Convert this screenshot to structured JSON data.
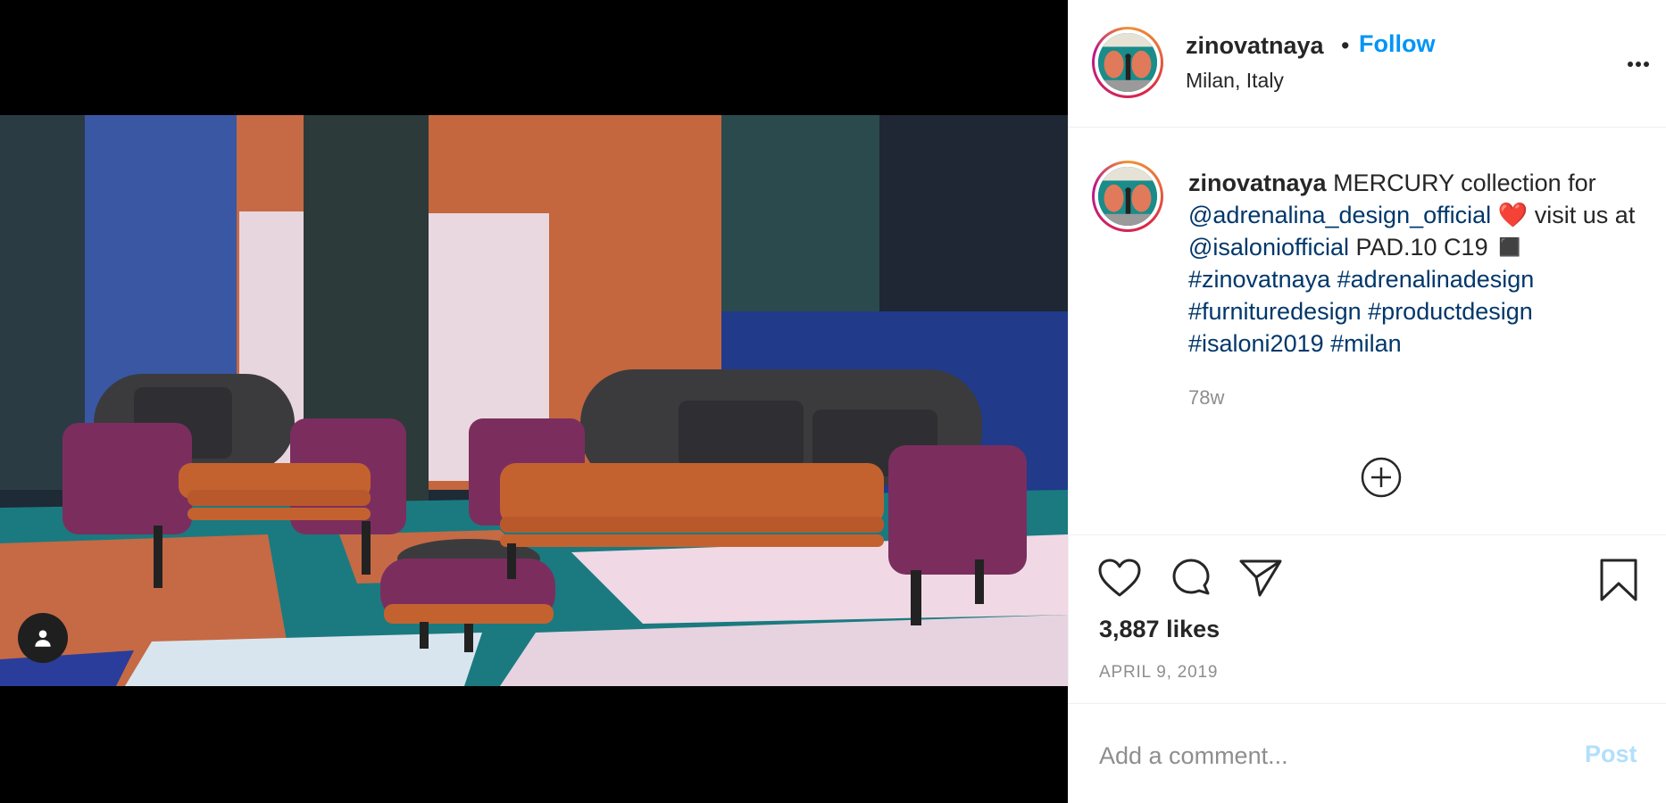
{
  "post": {
    "username": "zinovatnaya",
    "separator": "•",
    "follow_label": "Follow",
    "location": "Milan, Italy",
    "more_icon": "more-horizontal-icon"
  },
  "caption": {
    "username": "zinovatnaya",
    "text_1": " MERCURY collection for ",
    "mention_1": "@adrenalina_design_official",
    "heart_emoji": " ❤️ ",
    "text_2": "visit us at ",
    "mention_2": "@isaloniofficial",
    "text_3": " PAD.10 C19  ◼️",
    "hashtags": [
      "#zinovatnaya",
      "#adrenalinadesign",
      "#furnituredesign",
      "#productdesign",
      "#isaloni2019",
      "#milan"
    ],
    "age": "78w"
  },
  "stats": {
    "likes": "3,887 likes",
    "date": "APRIL 9, 2019"
  },
  "comment": {
    "placeholder": "Add a comment...",
    "post_label": "Post"
  },
  "colors": {
    "accent": "#0095f6",
    "link": "#00376b",
    "muted": "#8e8e8e",
    "post_disabled": "#b2dffc"
  },
  "icons": [
    "user-tag-icon",
    "heart-icon",
    "comment-icon",
    "share-icon",
    "bookmark-icon",
    "plus-circle-icon",
    "more-horizontal-icon"
  ]
}
